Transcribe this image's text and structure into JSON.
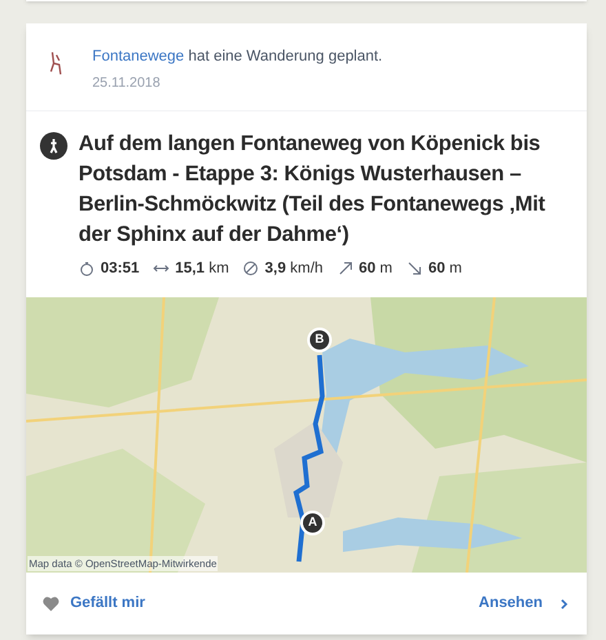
{
  "post": {
    "author": "Fontanewege",
    "action": "hat eine Wanderung geplant.",
    "date": "25.11.2018"
  },
  "tour": {
    "title": "Auf dem langen Fontaneweg von Köpenick bis Potsdam - Etappe 3: Königs Wusterhausen – Berlin-Schmöckwitz (Teil des Fontanewegs ‚Mit der Sphinx auf der Dahme‘)",
    "stats": [
      {
        "kind": "duration",
        "value": "03:51"
      },
      {
        "kind": "distance",
        "value": "15,1",
        "unit": "km"
      },
      {
        "kind": "speed",
        "value": "3,9",
        "unit": "km/h"
      },
      {
        "kind": "up",
        "value": "60",
        "unit": "m"
      },
      {
        "kind": "down",
        "value": "60",
        "unit": "m"
      }
    ]
  },
  "map": {
    "markers": [
      {
        "label": "A"
      },
      {
        "label": "B"
      }
    ],
    "attribution": "Map data © OpenStreetMap-Mitwirkende"
  },
  "footer": {
    "like": "Gefällt mir",
    "view": "Ansehen"
  }
}
